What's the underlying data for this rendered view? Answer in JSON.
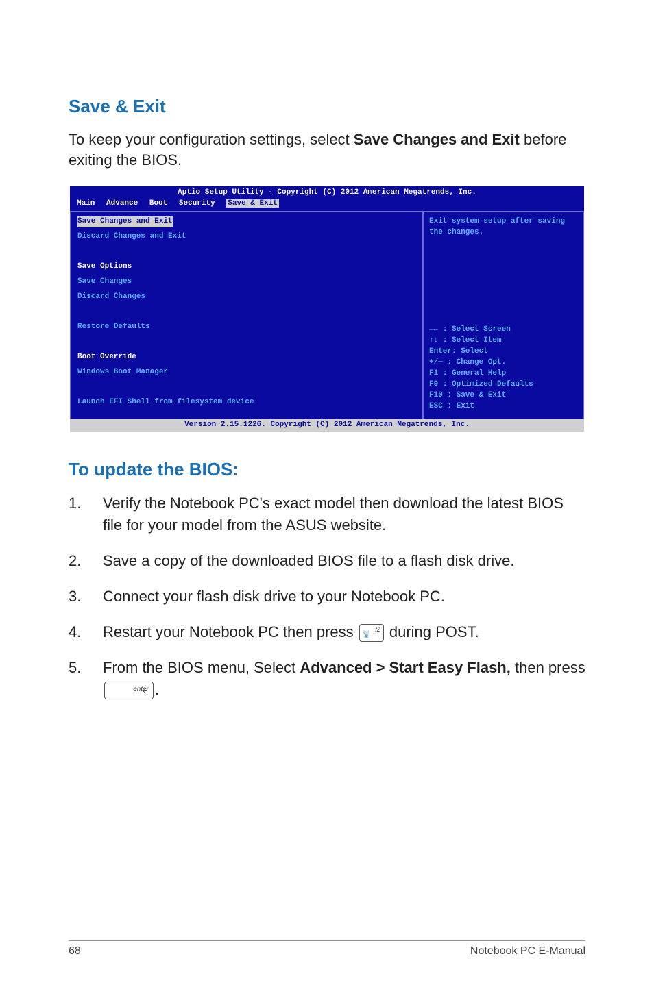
{
  "headings": {
    "save_exit": "Save & Exit",
    "update_bios": "To update the BIOS:"
  },
  "intro": {
    "pre": "To keep your configuration settings, select ",
    "bold": "Save Changes and Exit",
    "post": " before exiting the BIOS."
  },
  "bios": {
    "header": "Aptio Setup Utility - Copyright (C) 2012 American Megatrends, Inc.",
    "tabs": [
      "Main",
      "Advance",
      "Boot",
      "Security",
      "Save & Exit"
    ],
    "active_tab": "Save & Exit",
    "left": {
      "selected": "Save Changes and Exit",
      "items": [
        "Discard Changes and Exit",
        "",
        "Save Options",
        "Save Changes",
        "Discard Changes",
        "",
        "Restore Defaults",
        "",
        "Boot Override",
        "Windows Boot Manager",
        "",
        "Launch EFI Shell from filesystem device"
      ],
      "white_items": [
        "Save Options",
        "Boot Override"
      ]
    },
    "right": {
      "help_top": "Exit system setup after saving the changes.",
      "help_lines": [
        "→←   : Select Screen",
        "↑↓   : Select Item",
        "Enter: Select",
        "+/—  : Change Opt.",
        "F1   : General Help",
        "F9   : Optimized Defaults",
        "F10  : Save & Exit",
        "ESC  : Exit"
      ]
    },
    "footer": "Version 2.15.1226. Copyright (C) 2012 American Megatrends, Inc."
  },
  "steps": {
    "s1": "Verify the Notebook PC's exact model then download the latest BIOS file for your model from the ASUS website.",
    "s2": "Save a copy of the downloaded BIOS file to a flash disk drive.",
    "s3": "Connect your flash disk drive to your Notebook PC.",
    "s4_pre": "Restart your Notebook PC then press ",
    "s4_post": " during POST.",
    "s5_pre": "From the BIOS menu, Select ",
    "s5_bold": "Advanced > Start Easy Flash,",
    "s5_mid": " then press ",
    "s5_post": "."
  },
  "keys": {
    "f2_label": "f2",
    "f2_icon": "📡",
    "enter_label": "enter",
    "enter_glyph": "↵"
  },
  "footer": {
    "page": "68",
    "title": "Notebook PC E-Manual"
  }
}
